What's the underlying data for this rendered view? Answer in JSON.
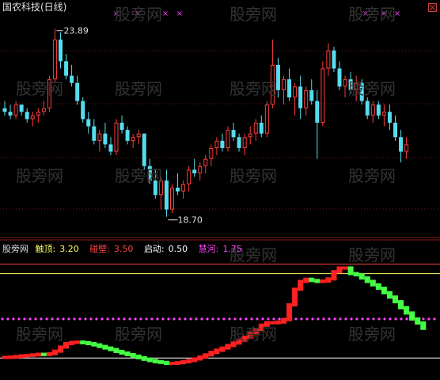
{
  "window": {
    "title": "国农科技(日线)"
  },
  "watermark": "股旁网",
  "colors": {
    "up": "#ff3c3c",
    "down": "#55ddee",
    "cross": "#ff44ff",
    "touch_top": "#ffff66",
    "hit_wall": "#ff4444",
    "start": "#ffffff",
    "sui_he": "#ff44ff",
    "green_seg": "#44ff44",
    "red_seg": "#ff2020"
  },
  "annotations": {
    "high": "23.89",
    "low": "18.70"
  },
  "indicator": {
    "name": "股旁网",
    "items": [
      {
        "label": "触顶:",
        "value": "3.20",
        "color": "#ffff66"
      },
      {
        "label": "碰壁:",
        "value": "3.50",
        "color": "#ff4444"
      },
      {
        "label": "启动:",
        "value": "0.50",
        "color": "#ffffff"
      },
      {
        "label": "慧河:",
        "value": "1.75",
        "color": "#ff44ff"
      }
    ]
  },
  "chart_data": [
    {
      "type": "candlestick",
      "title": "国农科技(日线)",
      "y_range": [
        18.3,
        24.3
      ],
      "annotations": [
        {
          "label": "23.89",
          "value": 23.89
        },
        {
          "label": "18.70",
          "value": 18.7
        }
      ],
      "candles": [
        [
          21.7,
          21.9,
          21.5,
          21.6
        ],
        [
          21.6,
          21.8,
          21.4,
          21.5
        ],
        [
          21.5,
          21.9,
          21.4,
          21.8
        ],
        [
          21.8,
          21.8,
          21.5,
          21.6
        ],
        [
          21.6,
          21.7,
          21.3,
          21.4
        ],
        [
          21.4,
          21.6,
          21.2,
          21.5
        ],
        [
          21.5,
          21.7,
          21.3,
          21.6
        ],
        [
          21.6,
          21.9,
          21.5,
          21.7
        ],
        [
          21.7,
          22.6,
          21.6,
          22.5
        ],
        [
          22.5,
          23.9,
          22.4,
          23.6
        ],
        [
          23.6,
          23.8,
          22.8,
          23.0
        ],
        [
          23.0,
          23.2,
          22.5,
          22.6
        ],
        [
          22.6,
          22.9,
          22.3,
          22.4
        ],
        [
          22.4,
          22.6,
          21.8,
          21.9
        ],
        [
          21.9,
          22.0,
          21.3,
          21.4
        ],
        [
          21.4,
          21.6,
          21.0,
          21.2
        ],
        [
          21.2,
          21.4,
          20.7,
          20.8
        ],
        [
          20.8,
          21.1,
          20.5,
          21.0
        ],
        [
          21.0,
          21.3,
          20.6,
          20.7
        ],
        [
          20.7,
          20.9,
          20.4,
          20.5
        ],
        [
          20.5,
          21.4,
          20.4,
          21.3
        ],
        [
          21.3,
          21.5,
          21.0,
          21.1
        ],
        [
          21.1,
          21.2,
          20.7,
          20.8
        ],
        [
          20.8,
          21.0,
          20.6,
          20.9
        ],
        [
          20.9,
          21.1,
          20.7,
          21.0
        ],
        [
          21.0,
          21.0,
          20.0,
          20.1
        ],
        [
          20.1,
          20.3,
          19.6,
          19.7
        ],
        [
          19.7,
          20.0,
          19.2,
          19.3
        ],
        [
          19.3,
          19.8,
          18.9,
          19.7
        ],
        [
          19.7,
          20.0,
          18.7,
          18.9
        ],
        [
          18.9,
          19.6,
          18.8,
          19.5
        ],
        [
          19.5,
          19.9,
          19.3,
          19.4
        ],
        [
          19.4,
          19.7,
          19.2,
          19.6
        ],
        [
          19.6,
          20.1,
          19.4,
          20.0
        ],
        [
          20.0,
          20.3,
          19.8,
          19.9
        ],
        [
          19.9,
          20.2,
          19.7,
          20.1
        ],
        [
          20.1,
          20.4,
          19.9,
          20.3
        ],
        [
          20.3,
          20.7,
          20.1,
          20.6
        ],
        [
          20.6,
          20.9,
          20.4,
          20.8
        ],
        [
          20.8,
          21.0,
          20.5,
          20.6
        ],
        [
          20.6,
          21.2,
          20.5,
          21.1
        ],
        [
          21.1,
          21.3,
          20.8,
          20.9
        ],
        [
          20.9,
          21.0,
          20.5,
          20.6
        ],
        [
          20.6,
          21.0,
          20.4,
          20.9
        ],
        [
          20.9,
          21.2,
          20.7,
          21.0
        ],
        [
          21.0,
          21.4,
          20.8,
          21.3
        ],
        [
          21.3,
          21.5,
          20.9,
          21.0
        ],
        [
          21.0,
          21.9,
          20.9,
          21.8
        ],
        [
          21.8,
          23.6,
          21.7,
          22.9
        ],
        [
          22.9,
          23.1,
          22.0,
          22.2
        ],
        [
          22.2,
          22.6,
          21.8,
          22.5
        ],
        [
          22.5,
          22.8,
          21.9,
          22.0
        ],
        [
          22.0,
          22.4,
          21.5,
          22.3
        ],
        [
          22.3,
          22.6,
          21.4,
          21.7
        ],
        [
          21.7,
          22.3,
          21.5,
          22.2
        ],
        [
          22.2,
          22.5,
          21.8,
          21.9
        ],
        [
          21.9,
          22.2,
          20.3,
          21.3
        ],
        [
          21.3,
          23.0,
          21.2,
          22.8
        ],
        [
          22.8,
          23.5,
          22.6,
          23.3
        ],
        [
          23.3,
          23.4,
          22.7,
          22.8
        ],
        [
          22.8,
          23.0,
          22.2,
          22.3
        ],
        [
          22.3,
          22.6,
          22.0,
          22.5
        ],
        [
          22.5,
          22.7,
          22.1,
          22.2
        ],
        [
          22.2,
          22.6,
          21.9,
          22.4
        ],
        [
          22.4,
          22.5,
          21.8,
          21.9
        ],
        [
          21.9,
          22.0,
          21.4,
          21.5
        ],
        [
          21.5,
          21.9,
          21.3,
          21.8
        ],
        [
          21.8,
          21.9,
          21.4,
          21.5
        ],
        [
          21.5,
          21.8,
          21.2,
          21.6
        ],
        [
          21.6,
          21.8,
          21.1,
          21.3
        ],
        [
          21.3,
          21.5,
          20.8,
          20.9
        ],
        [
          20.9,
          21.1,
          20.2,
          20.5
        ],
        [
          20.5,
          20.9,
          20.3,
          20.7
        ]
      ]
    },
    {
      "type": "line",
      "title": "股旁网",
      "y_range": [
        0,
        4.0
      ],
      "reference_lines": [
        {
          "name": "触顶",
          "value": 3.2
        },
        {
          "name": "碰壁",
          "value": 3.5
        },
        {
          "name": "启动",
          "value": 0.5
        },
        {
          "name": "慧河",
          "value": 1.75
        }
      ],
      "series": [
        {
          "values": [
            0.52,
            0.53,
            0.55,
            0.57,
            0.58,
            0.6,
            0.62,
            0.61,
            0.64,
            0.72,
            0.85,
            0.96,
            1.0,
            1.01,
            0.99,
            0.96,
            0.92,
            0.87,
            0.82,
            0.77,
            0.71,
            0.66,
            0.61,
            0.56,
            0.51,
            0.46,
            0.42,
            0.38,
            0.36,
            0.33,
            0.33,
            0.35,
            0.38,
            0.42,
            0.47,
            0.53,
            0.6,
            0.68,
            0.75,
            0.82,
            0.9,
            0.98,
            1.07,
            1.17,
            1.28,
            1.41,
            1.55,
            1.63,
            1.63,
            1.65,
            1.73,
            2.2,
            2.7,
            2.95,
            3.02,
            2.98,
            2.95,
            2.96,
            3.03,
            3.26,
            3.38,
            3.38,
            3.2,
            3.16,
            3.06,
            2.95,
            2.84,
            2.73,
            2.59,
            2.45,
            2.3,
            2.11,
            1.94,
            1.75,
            1.62,
            1.45
          ]
        }
      ]
    }
  ]
}
